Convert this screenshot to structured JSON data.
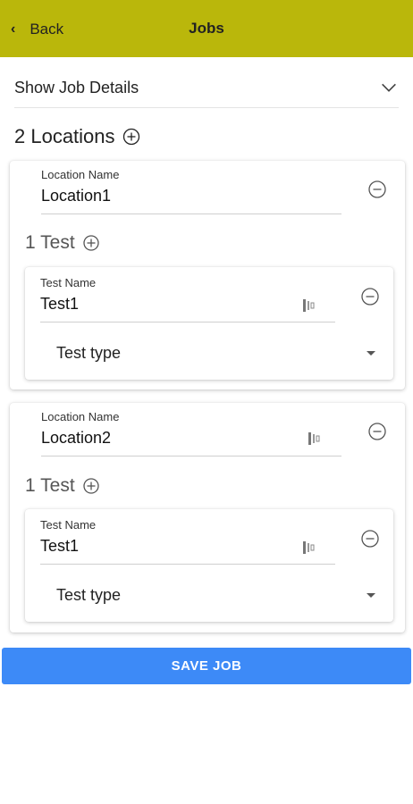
{
  "header": {
    "back_label": "Back",
    "title": "Jobs",
    "color": "#bab70b"
  },
  "details": {
    "label": "Show Job Details"
  },
  "locations": {
    "title": "2 Locations",
    "items": [
      {
        "name_label": "Location Name",
        "name_value": "Location1",
        "tests_title": "1 Test",
        "test": {
          "name_label": "Test Name",
          "name_value": "Test1",
          "type_placeholder": "Test type"
        }
      },
      {
        "name_label": "Location Name",
        "name_value": "Location2",
        "tests_title": "1 Test",
        "test": {
          "name_label": "Test Name",
          "name_value": "Test1",
          "type_placeholder": "Test type"
        }
      }
    ]
  },
  "save": {
    "label": "SAVE JOB",
    "color": "#3d8af7"
  }
}
